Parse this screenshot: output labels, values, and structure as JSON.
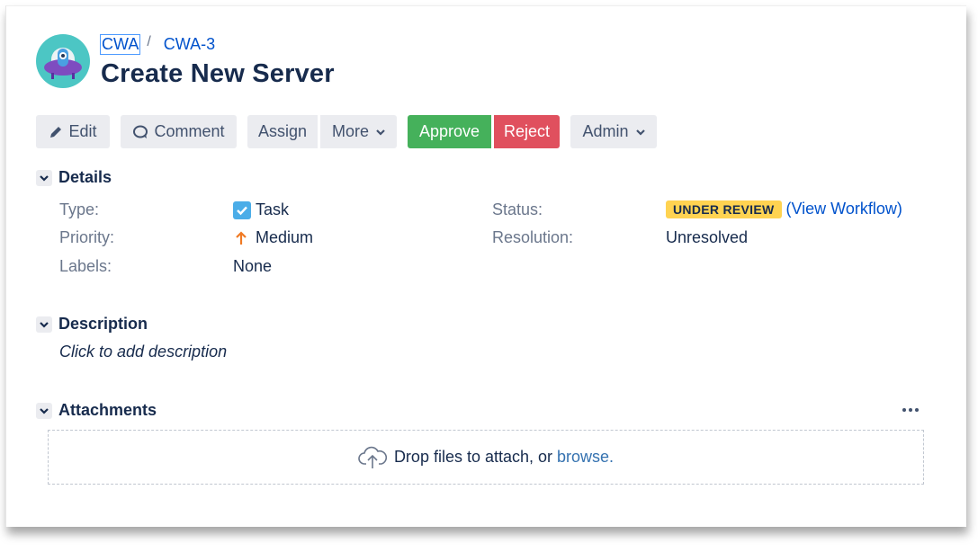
{
  "breadcrumb": {
    "project": "CWA",
    "separator": "/",
    "issue_key": "CWA-3"
  },
  "issue": {
    "title": "Create New Server"
  },
  "toolbar": {
    "edit": "Edit",
    "comment": "Comment",
    "assign": "Assign",
    "more": "More",
    "approve": "Approve",
    "reject": "Reject",
    "admin": "Admin"
  },
  "details": {
    "heading": "Details",
    "type_label": "Type:",
    "type_value": "Task",
    "priority_label": "Priority:",
    "priority_value": "Medium",
    "labels_label": "Labels:",
    "labels_value": "None",
    "status_label": "Status:",
    "status_value": "UNDER REVIEW",
    "view_workflow": "(View Workflow)",
    "resolution_label": "Resolution:",
    "resolution_value": "Unresolved"
  },
  "description": {
    "heading": "Description",
    "placeholder": "Click to add description"
  },
  "attachments": {
    "heading": "Attachments",
    "drop_text": "Drop files to attach, or",
    "browse": "browse."
  },
  "colors": {
    "approve": "#45b15b",
    "reject": "#e0505e",
    "status_lozenge": "#ffd351",
    "link": "#0052cc",
    "priority_medium": "#f07a24"
  }
}
